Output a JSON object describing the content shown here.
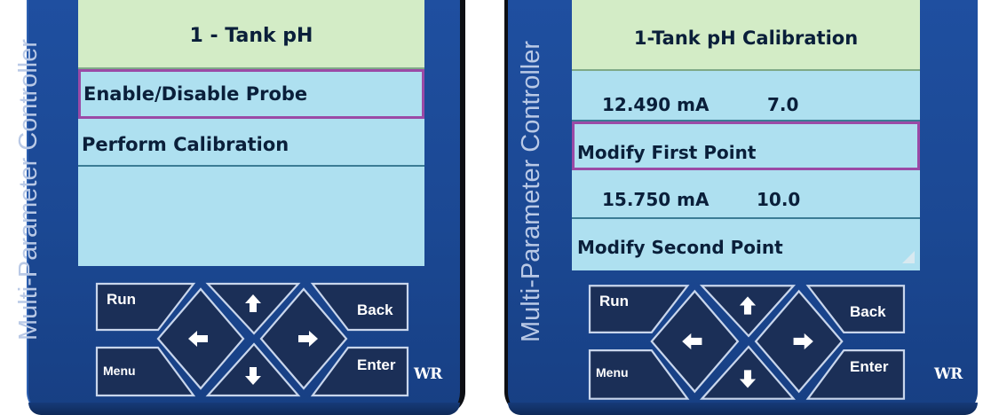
{
  "device_label": "Multi-Parameter Controller",
  "logo_text": "WR",
  "left_screen": {
    "title": "1 - Tank pH",
    "items": [
      "Enable/Disable Probe",
      "Perform Calibration"
    ]
  },
  "right_screen": {
    "title": "1-Tank pH Calibration",
    "point1": {
      "current": "12.490 mA",
      "ph": "7.0"
    },
    "modify_first": "Modify First Point",
    "point2": {
      "current": "15.750 mA",
      "ph": "10.0"
    },
    "modify_second": "Modify Second Point"
  },
  "keypad": {
    "run": "Run",
    "back": "Back",
    "menu": "Menu",
    "enter": "Enter",
    "up_icon": "arrow-up-icon",
    "down_icon": "arrow-down-icon",
    "left_icon": "arrow-left-icon",
    "right_icon": "arrow-right-icon"
  },
  "colors": {
    "body": "#1f4fa0",
    "screen": "#aee0f0",
    "title_bar": "#d3ecc6",
    "selection": "#9b4aa6",
    "keys": "#1b2f57"
  }
}
